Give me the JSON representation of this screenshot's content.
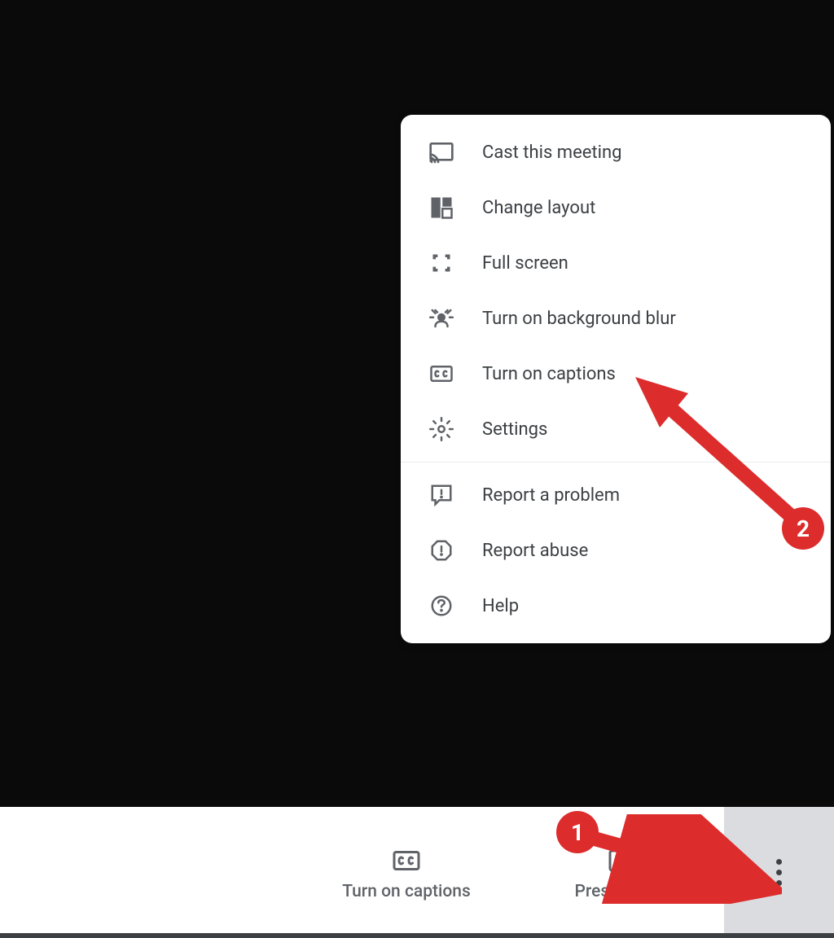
{
  "menu": {
    "items": [
      {
        "icon": "cast-icon",
        "label": "Cast this meeting"
      },
      {
        "icon": "layout-icon",
        "label": "Change layout"
      },
      {
        "icon": "fullscreen-icon",
        "label": "Full screen"
      },
      {
        "icon": "blur-icon",
        "label": "Turn on background blur"
      },
      {
        "icon": "captions-icon",
        "label": "Turn on captions"
      },
      {
        "icon": "settings-icon",
        "label": "Settings"
      }
    ],
    "secondary": [
      {
        "icon": "report-problem-icon",
        "label": "Report a problem"
      },
      {
        "icon": "report-abuse-icon",
        "label": "Report abuse"
      },
      {
        "icon": "help-icon",
        "label": "Help"
      }
    ]
  },
  "bottom_bar": {
    "captions_label": "Turn on captions",
    "present_label": "Present now"
  },
  "annotations": {
    "badge_1": "1",
    "badge_2": "2"
  },
  "colors": {
    "accent_red": "#dd2c2c",
    "icon_gray": "#5f6368",
    "text_gray": "#3c4043"
  }
}
